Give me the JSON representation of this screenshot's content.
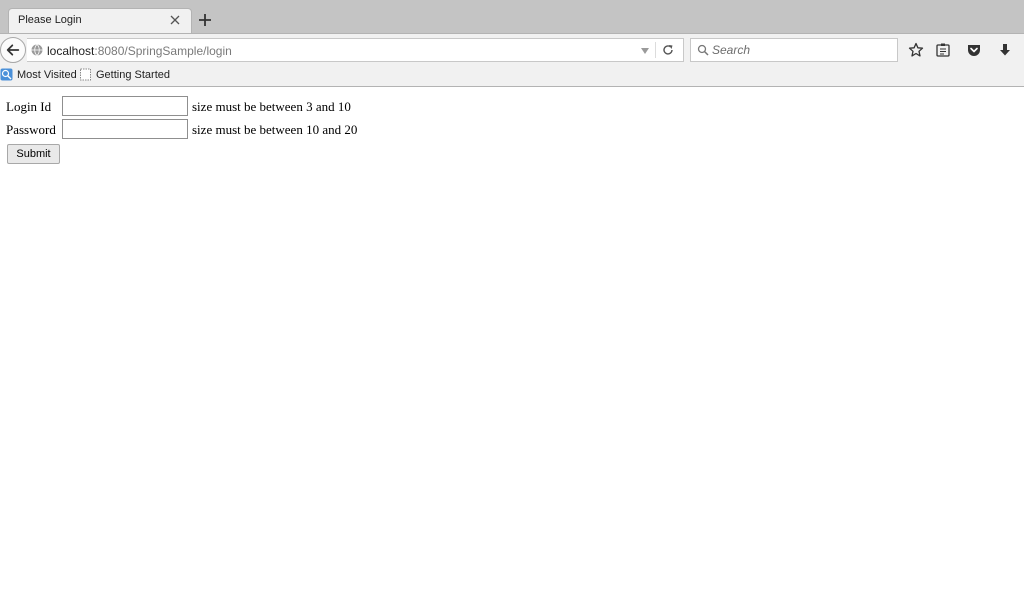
{
  "browser": {
    "tab": {
      "title": "Please Login"
    },
    "address": {
      "host": "localhost",
      "rest": ":8080/SpringSample/login"
    },
    "search": {
      "placeholder": "Search"
    },
    "bookmarks": [
      {
        "label": "Most Visited",
        "icon": "most-visited-icon"
      },
      {
        "label": "Getting Started",
        "icon": "page-icon"
      }
    ],
    "toolbar_icons": [
      "star-icon",
      "reading-list-icon",
      "pocket-icon",
      "download-icon"
    ]
  },
  "form": {
    "login": {
      "label": "Login Id",
      "value": "",
      "error": "size must be between 3 and 10"
    },
    "password": {
      "label": "Password",
      "value": "",
      "error": "size must be between 10 and 20"
    },
    "submit_label": "Submit"
  }
}
